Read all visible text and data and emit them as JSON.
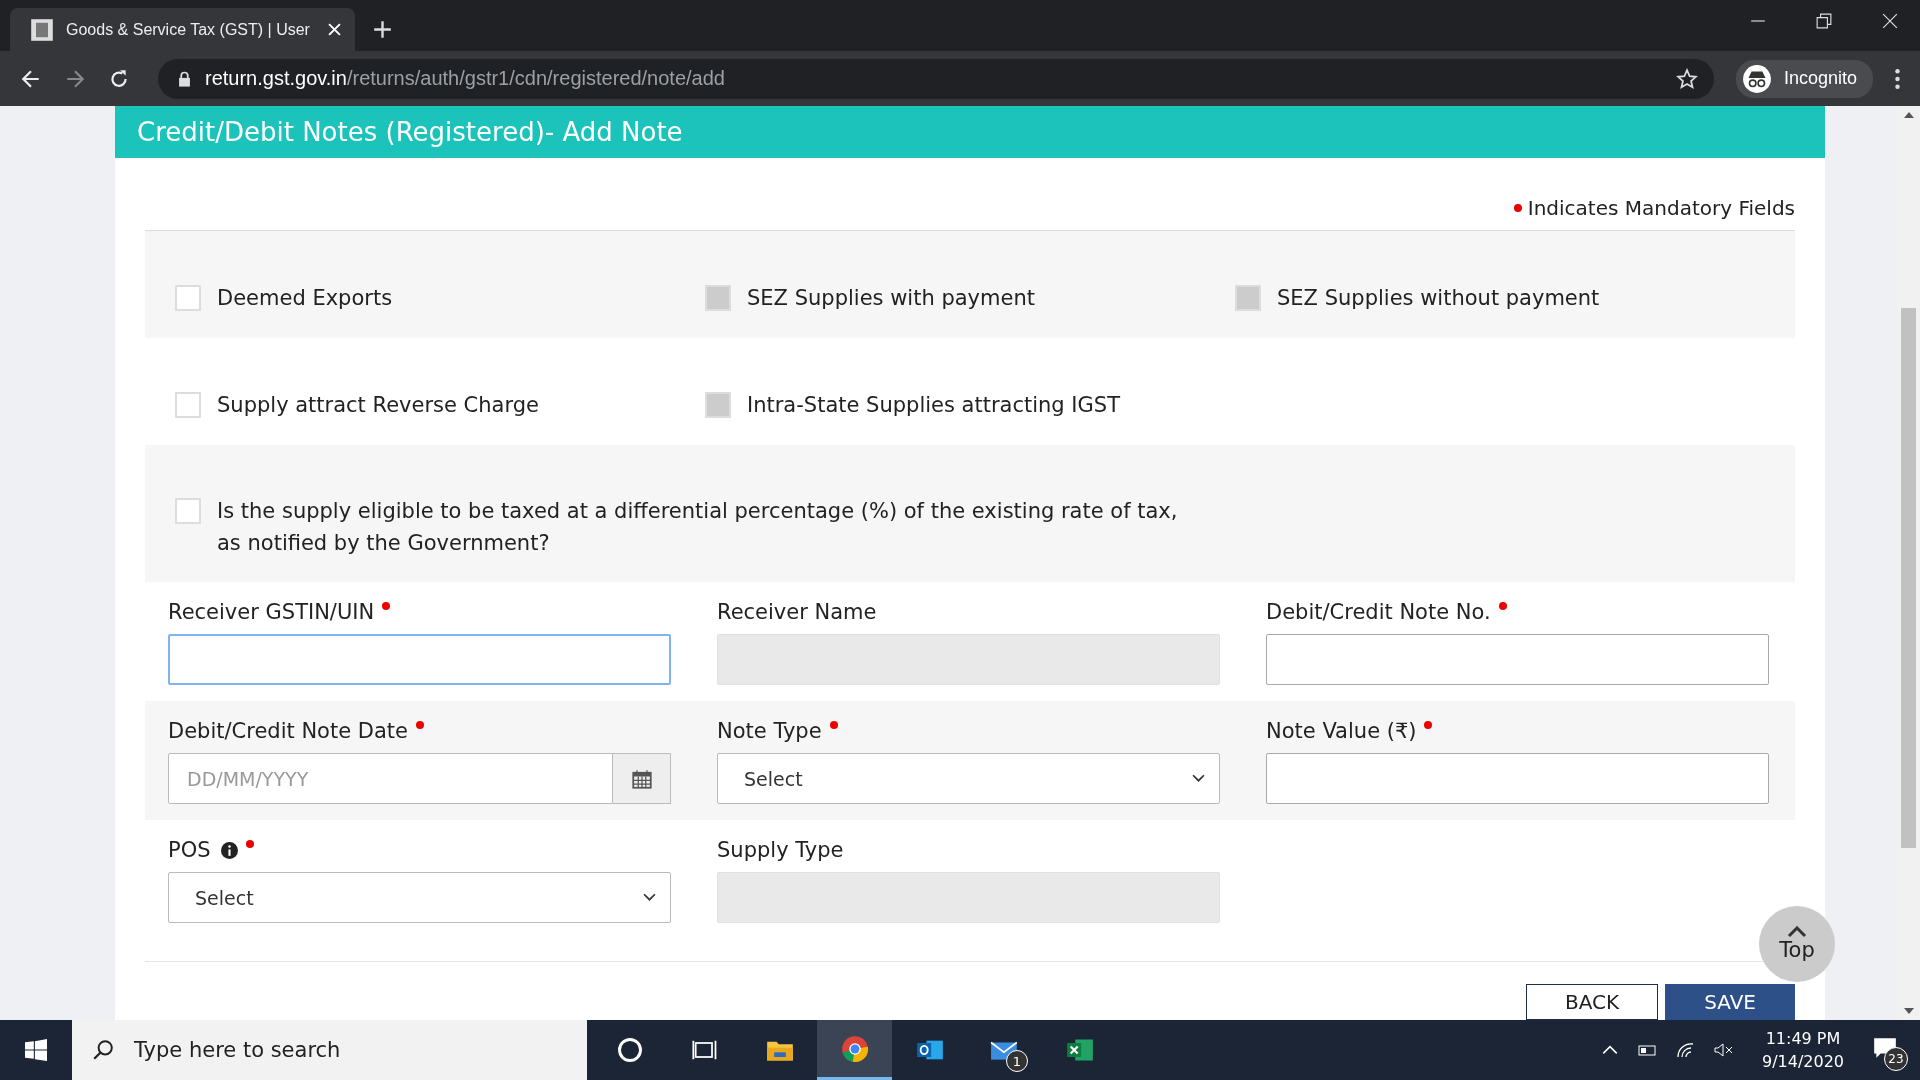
{
  "browser": {
    "tab_title": "Goods & Service Tax (GST) | User",
    "url_host": "return.gst.gov.in",
    "url_path": "/returns/auth/gstr1/cdn/registered/note/add",
    "profile": "Incognito"
  },
  "page": {
    "title": "Credit/Debit Notes (Registered)- Add Note",
    "mandatory_note": "Indicates Mandatory Fields"
  },
  "checkbox_rows": [
    [
      {
        "label": "Deemed Exports",
        "checked": false,
        "disabled": false
      },
      {
        "label": "SEZ Supplies with payment",
        "checked": false,
        "disabled": true
      },
      {
        "label": "SEZ Supplies without payment",
        "checked": false,
        "disabled": true
      }
    ],
    [
      {
        "label": "Supply attract Reverse Charge",
        "checked": false,
        "disabled": false
      },
      {
        "label": "Intra-State Supplies attracting IGST",
        "checked": false,
        "disabled": true
      }
    ],
    [
      {
        "label": "Is the supply eligible to be taxed at a differential percentage (%) of the existing rate of tax, as notified by the Government?",
        "checked": false,
        "disabled": false
      }
    ]
  ],
  "field_rows": [
    [
      {
        "kind": "text",
        "label": "Receiver GSTIN/UIN",
        "required": true,
        "disabled": false,
        "focused": true
      },
      {
        "kind": "text",
        "label": "Receiver Name",
        "required": false,
        "disabled": true,
        "focused": false
      },
      {
        "kind": "text",
        "label": "Debit/Credit Note No.",
        "required": true,
        "disabled": false,
        "focused": false
      }
    ],
    [
      {
        "kind": "date",
        "label": "Debit/Credit Note Date",
        "required": true,
        "placeholder": "DD/MM/YYYY"
      },
      {
        "kind": "select",
        "label": "Note Type",
        "required": true,
        "value": "Select"
      },
      {
        "kind": "text",
        "label": "Note Value (₹)",
        "required": true,
        "disabled": false,
        "focused": false
      }
    ],
    [
      {
        "kind": "select",
        "label": "POS",
        "required": true,
        "value": "Select",
        "info": true
      },
      {
        "kind": "text",
        "label": "Supply Type",
        "required": false,
        "disabled": true,
        "focused": false
      }
    ]
  ],
  "buttons": [
    {
      "label": "BACK",
      "kind": "secondary"
    },
    {
      "label": "SAVE",
      "kind": "primary"
    }
  ],
  "top_button": {
    "label": "Top"
  },
  "taskbar": {
    "search_placeholder": "Type here to search",
    "mail_badge": "1",
    "time": "11:49 PM",
    "date": "9/14/2020",
    "notifications": "23"
  }
}
